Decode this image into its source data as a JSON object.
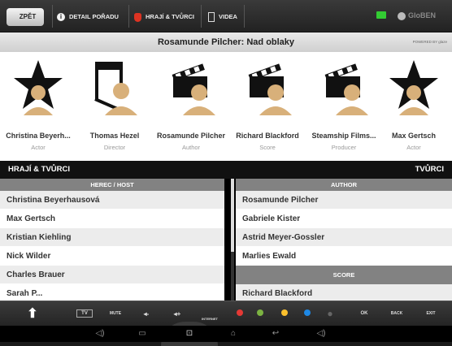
{
  "topbar": {
    "back_label": "ZPĚT",
    "tabs": [
      {
        "label": "DETAIL POŘADU",
        "icon": "info-icon"
      },
      {
        "label": "HRAJÍ & TVŮRCI",
        "icon": "masks-icon"
      },
      {
        "label": "VIDEA",
        "icon": "film-icon"
      }
    ],
    "brand": "GloBEN"
  },
  "title": "Rosamunde Pilcher: Nad oblaky",
  "powered_by": "POWERED BY glaze",
  "people": [
    {
      "name": "Christina Beyerh...",
      "role": "Actor",
      "icon": "star-person-icon"
    },
    {
      "name": "Thomas Hezel",
      "role": "Director",
      "icon": "director-chair-person-icon"
    },
    {
      "name": "Rosamunde Pilcher",
      "role": "Author",
      "icon": "clapperboard-person-icon"
    },
    {
      "name": "Richard Blackford",
      "role": "Score",
      "icon": "clapperboard-person-icon"
    },
    {
      "name": "Steamship Films...",
      "role": "Producer",
      "icon": "clapperboard-person-icon"
    },
    {
      "name": "Max Gertsch",
      "role": "Actor",
      "icon": "star-person-icon"
    }
  ],
  "section": {
    "left": "HRAJÍ & TVŮRCI",
    "right": "TVŮRCI"
  },
  "cast": {
    "header": "HEREC / HOST",
    "rows": [
      "Christina Beyerhausová",
      "Max Gertsch",
      "Kristian Kiehling",
      "Nick Wilder",
      "Charles Brauer",
      "Sarah P..."
    ]
  },
  "crew": {
    "author_header": "AUTHOR",
    "author_rows": [
      "Rosamunde Pilcher",
      "Gabriele Kister",
      "Astrid Meyer-Gossler",
      "Marlies Ewald"
    ],
    "score_header": "SCORE",
    "score_rows": [
      "Richard Blackford"
    ]
  },
  "controls": {
    "tv_label": "TV",
    "mute": "MUTE",
    "vol_down": "◂-",
    "vol_up": "◂+",
    "internet": "INTERNET",
    "ok": "OK",
    "back": "BACK",
    "exit": "EXIT",
    "colors": [
      "#e53935",
      "#7cb342",
      "#fbc02d",
      "#1e88e5"
    ]
  },
  "android_nav": [
    "◁)",
    "▭",
    "⊡",
    "⌂",
    "↩",
    "◁)"
  ]
}
